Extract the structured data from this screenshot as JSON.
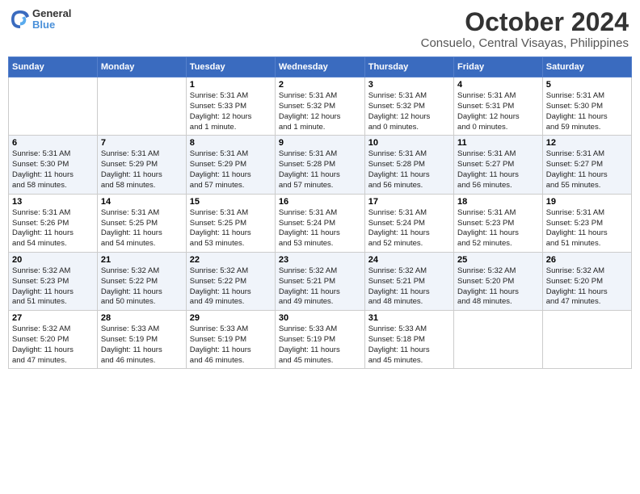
{
  "header": {
    "logo_line1": "General",
    "logo_line2": "Blue",
    "month": "October 2024",
    "location": "Consuelo, Central Visayas, Philippines"
  },
  "weekdays": [
    "Sunday",
    "Monday",
    "Tuesday",
    "Wednesday",
    "Thursday",
    "Friday",
    "Saturday"
  ],
  "weeks": [
    [
      {
        "day": "",
        "info": ""
      },
      {
        "day": "",
        "info": ""
      },
      {
        "day": "1",
        "info": "Sunrise: 5:31 AM\nSunset: 5:33 PM\nDaylight: 12 hours\nand 1 minute."
      },
      {
        "day": "2",
        "info": "Sunrise: 5:31 AM\nSunset: 5:32 PM\nDaylight: 12 hours\nand 1 minute."
      },
      {
        "day": "3",
        "info": "Sunrise: 5:31 AM\nSunset: 5:32 PM\nDaylight: 12 hours\nand 0 minutes."
      },
      {
        "day": "4",
        "info": "Sunrise: 5:31 AM\nSunset: 5:31 PM\nDaylight: 12 hours\nand 0 minutes."
      },
      {
        "day": "5",
        "info": "Sunrise: 5:31 AM\nSunset: 5:30 PM\nDaylight: 11 hours\nand 59 minutes."
      }
    ],
    [
      {
        "day": "6",
        "info": "Sunrise: 5:31 AM\nSunset: 5:30 PM\nDaylight: 11 hours\nand 58 minutes."
      },
      {
        "day": "7",
        "info": "Sunrise: 5:31 AM\nSunset: 5:29 PM\nDaylight: 11 hours\nand 58 minutes."
      },
      {
        "day": "8",
        "info": "Sunrise: 5:31 AM\nSunset: 5:29 PM\nDaylight: 11 hours\nand 57 minutes."
      },
      {
        "day": "9",
        "info": "Sunrise: 5:31 AM\nSunset: 5:28 PM\nDaylight: 11 hours\nand 57 minutes."
      },
      {
        "day": "10",
        "info": "Sunrise: 5:31 AM\nSunset: 5:28 PM\nDaylight: 11 hours\nand 56 minutes."
      },
      {
        "day": "11",
        "info": "Sunrise: 5:31 AM\nSunset: 5:27 PM\nDaylight: 11 hours\nand 56 minutes."
      },
      {
        "day": "12",
        "info": "Sunrise: 5:31 AM\nSunset: 5:27 PM\nDaylight: 11 hours\nand 55 minutes."
      }
    ],
    [
      {
        "day": "13",
        "info": "Sunrise: 5:31 AM\nSunset: 5:26 PM\nDaylight: 11 hours\nand 54 minutes."
      },
      {
        "day": "14",
        "info": "Sunrise: 5:31 AM\nSunset: 5:25 PM\nDaylight: 11 hours\nand 54 minutes."
      },
      {
        "day": "15",
        "info": "Sunrise: 5:31 AM\nSunset: 5:25 PM\nDaylight: 11 hours\nand 53 minutes."
      },
      {
        "day": "16",
        "info": "Sunrise: 5:31 AM\nSunset: 5:24 PM\nDaylight: 11 hours\nand 53 minutes."
      },
      {
        "day": "17",
        "info": "Sunrise: 5:31 AM\nSunset: 5:24 PM\nDaylight: 11 hours\nand 52 minutes."
      },
      {
        "day": "18",
        "info": "Sunrise: 5:31 AM\nSunset: 5:23 PM\nDaylight: 11 hours\nand 52 minutes."
      },
      {
        "day": "19",
        "info": "Sunrise: 5:31 AM\nSunset: 5:23 PM\nDaylight: 11 hours\nand 51 minutes."
      }
    ],
    [
      {
        "day": "20",
        "info": "Sunrise: 5:32 AM\nSunset: 5:23 PM\nDaylight: 11 hours\nand 51 minutes."
      },
      {
        "day": "21",
        "info": "Sunrise: 5:32 AM\nSunset: 5:22 PM\nDaylight: 11 hours\nand 50 minutes."
      },
      {
        "day": "22",
        "info": "Sunrise: 5:32 AM\nSunset: 5:22 PM\nDaylight: 11 hours\nand 49 minutes."
      },
      {
        "day": "23",
        "info": "Sunrise: 5:32 AM\nSunset: 5:21 PM\nDaylight: 11 hours\nand 49 minutes."
      },
      {
        "day": "24",
        "info": "Sunrise: 5:32 AM\nSunset: 5:21 PM\nDaylight: 11 hours\nand 48 minutes."
      },
      {
        "day": "25",
        "info": "Sunrise: 5:32 AM\nSunset: 5:20 PM\nDaylight: 11 hours\nand 48 minutes."
      },
      {
        "day": "26",
        "info": "Sunrise: 5:32 AM\nSunset: 5:20 PM\nDaylight: 11 hours\nand 47 minutes."
      }
    ],
    [
      {
        "day": "27",
        "info": "Sunrise: 5:32 AM\nSunset: 5:20 PM\nDaylight: 11 hours\nand 47 minutes."
      },
      {
        "day": "28",
        "info": "Sunrise: 5:33 AM\nSunset: 5:19 PM\nDaylight: 11 hours\nand 46 minutes."
      },
      {
        "day": "29",
        "info": "Sunrise: 5:33 AM\nSunset: 5:19 PM\nDaylight: 11 hours\nand 46 minutes."
      },
      {
        "day": "30",
        "info": "Sunrise: 5:33 AM\nSunset: 5:19 PM\nDaylight: 11 hours\nand 45 minutes."
      },
      {
        "day": "31",
        "info": "Sunrise: 5:33 AM\nSunset: 5:18 PM\nDaylight: 11 hours\nand 45 minutes."
      },
      {
        "day": "",
        "info": ""
      },
      {
        "day": "",
        "info": ""
      }
    ]
  ]
}
